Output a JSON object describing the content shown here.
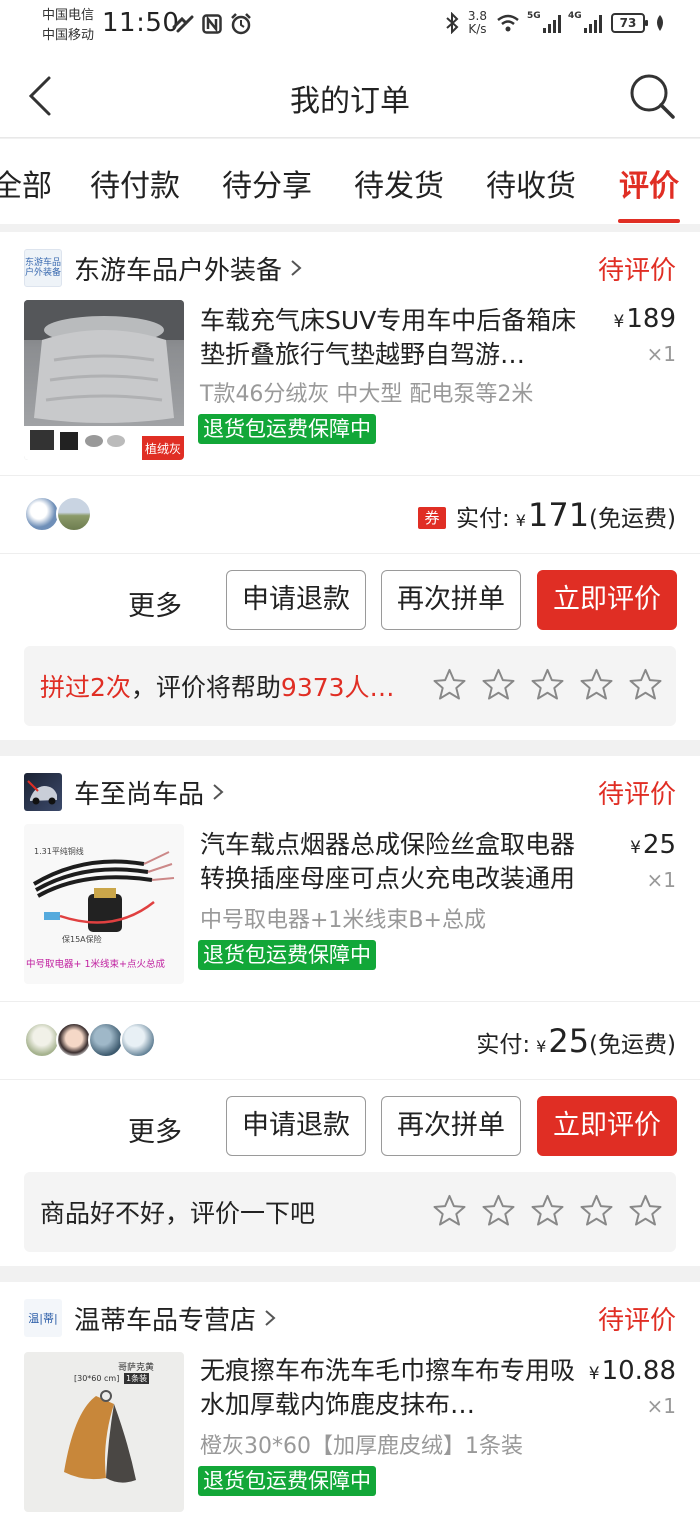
{
  "statusbar": {
    "carrier1": "中国电信",
    "carrier2": "中国移动",
    "time": "11:50",
    "speed_value": "3.8",
    "speed_unit": "K/s",
    "net1": "5G",
    "net2": "4G",
    "battery": "73"
  },
  "header": {
    "title": "我的订单"
  },
  "tabs": [
    {
      "label": "全部"
    },
    {
      "label": "待付款"
    },
    {
      "label": "待分享"
    },
    {
      "label": "待发货"
    },
    {
      "label": "待收货"
    },
    {
      "label": "评价"
    }
  ],
  "orders": [
    {
      "shop": "东游车品户外装备",
      "shop_logo_text": "东游车品户外装备",
      "status": "待评价",
      "title": "车载充气床SUV专用车中后备箱床垫折叠旅行气垫越野自驾游…",
      "spec": "T款46分绒灰 中大型 配电泵等2米",
      "badge": "退货包运费保障中",
      "price_symbol": "¥",
      "price": "189",
      "qty": "×1",
      "coupon": "券",
      "paid_label": "实付:",
      "paid_symbol": "¥",
      "paid_amount": "171",
      "shipping": "(免运费)",
      "img_label": "植绒灰",
      "btn_more": "更多",
      "btn_refund": "申请退款",
      "btn_rebuy": "再次拼单",
      "btn_review": "立即评价",
      "review_prefix": "拼过2次",
      "review_mid": "，评价将帮助",
      "review_count": "9373人…"
    },
    {
      "shop": "车至尚车品",
      "status": "待评价",
      "title": "汽车载点烟器总成保险丝盒取电器转换插座母座可点火充电改装通用",
      "spec": "中号取电器+1米线束B+总成",
      "badge": "退货包运费保障中",
      "price_symbol": "¥",
      "price": "25",
      "qty": "×1",
      "paid_label": "实付:",
      "paid_symbol": "¥",
      "paid_amount": "25",
      "shipping": "(免运费)",
      "img_top_label": "1.31平纯铜线",
      "img_mid_label": "保15A保险",
      "img_label": "中号取电器+ 1米线束+点火总成",
      "btn_more": "更多",
      "btn_refund": "申请退款",
      "btn_rebuy": "再次拼单",
      "btn_review": "立即评价",
      "review_text": "商品好不好，评价一下吧"
    },
    {
      "shop": "温蒂车品专营店",
      "shop_logo_text": "温|蒂|",
      "status": "待评价",
      "title": "无痕擦车布洗车毛巾擦车布专用吸水加厚载内饰鹿皮抹布…",
      "spec": "橙灰30*60【加厚鹿皮绒】1条装",
      "badge": "退货包运费保障中",
      "price_symbol": "¥",
      "price": "10.88",
      "qty": "×1",
      "img_label1": "哥萨克黄",
      "img_label2": "[30*60 cm]",
      "img_label3": "1条装"
    }
  ],
  "colors": {
    "accent": "#e02e24",
    "badge_green": "#12a738"
  }
}
